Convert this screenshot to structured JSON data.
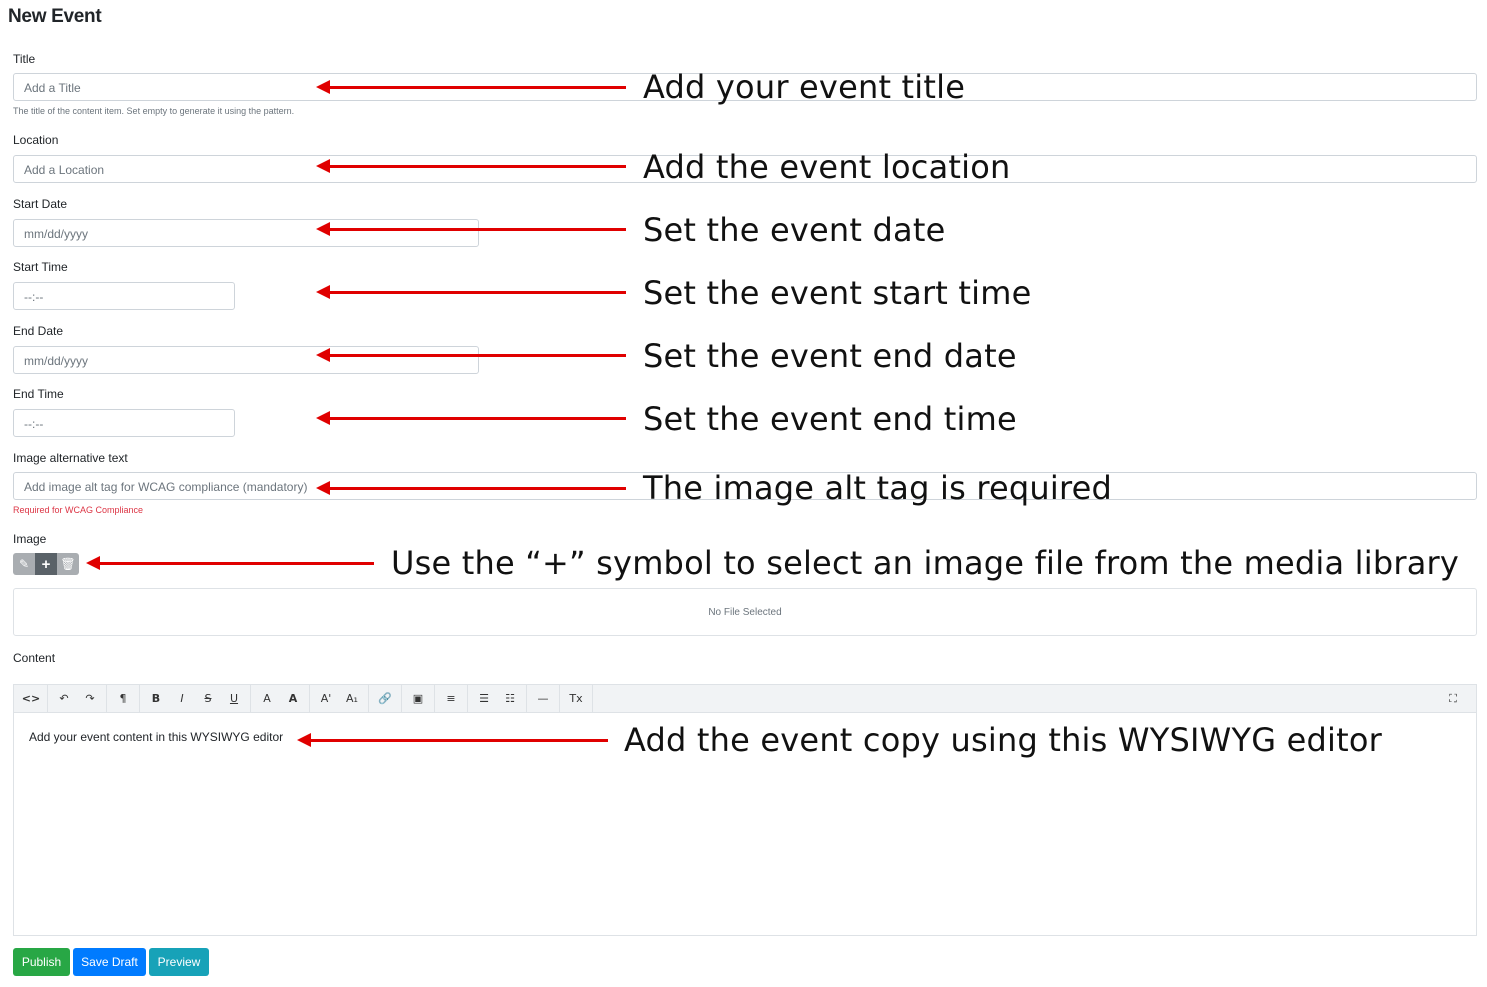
{
  "page_title": "New Event",
  "fields": {
    "title": {
      "label": "Title",
      "placeholder": "Add a Title",
      "help": "The title of the content item. Set empty to generate it using the pattern."
    },
    "location": {
      "label": "Location",
      "placeholder": "Add a Location"
    },
    "start_date": {
      "label": "Start Date",
      "placeholder": "mm/dd/yyyy"
    },
    "start_time": {
      "label": "Start Time",
      "placeholder": "--:--"
    },
    "end_date": {
      "label": "End Date",
      "placeholder": "mm/dd/yyyy"
    },
    "end_time": {
      "label": "End Time",
      "placeholder": "--:--"
    },
    "image_alt": {
      "label": "Image alternative text",
      "placeholder": "Add image alt tag for WCAG compliance (mandatory)",
      "help": "Required for WCAG Compliance"
    }
  },
  "image": {
    "label": "Image",
    "buttons": {
      "edit": "✎",
      "add": "+",
      "delete": "🗑"
    },
    "empty_text": "No File Selected"
  },
  "content": {
    "label": "Content",
    "toolbar": {
      "code": "<>",
      "undo": "↶",
      "redo": "↷",
      "paragraph": "¶",
      "bold": "B",
      "italic": "I",
      "strike": "S",
      "underline": "U",
      "font_color": "A",
      "highlight": "A",
      "superscript": "A'",
      "subscript": "A₁",
      "link": "🔗",
      "image": "▣",
      "align": "≡",
      "bullet_list": "☰",
      "number_list": "☷",
      "hr": "—",
      "clear_format": "Tx",
      "fullscreen": "⛶"
    },
    "body": "Add your event content in this WYSIWYG editor"
  },
  "actions": {
    "publish": "Publish",
    "save_draft": "Save Draft",
    "preview": "Preview"
  },
  "annotations": {
    "title": "Add your event title",
    "location": "Add the event location",
    "start_date": "Set the event date",
    "start_time": "Set the event start time",
    "end_date": "Set the event end date",
    "end_time": "Set the event end time",
    "image_alt": "The image alt tag is required",
    "image": "Use the “+” symbol to select an image file from the media library",
    "content": "Add the event copy using this WYSIWYG editor"
  },
  "colors": {
    "arrow": "#e00000",
    "publish": "#28a745",
    "save_draft": "#007bff",
    "preview": "#17a2b8",
    "required": "#dc3545"
  }
}
